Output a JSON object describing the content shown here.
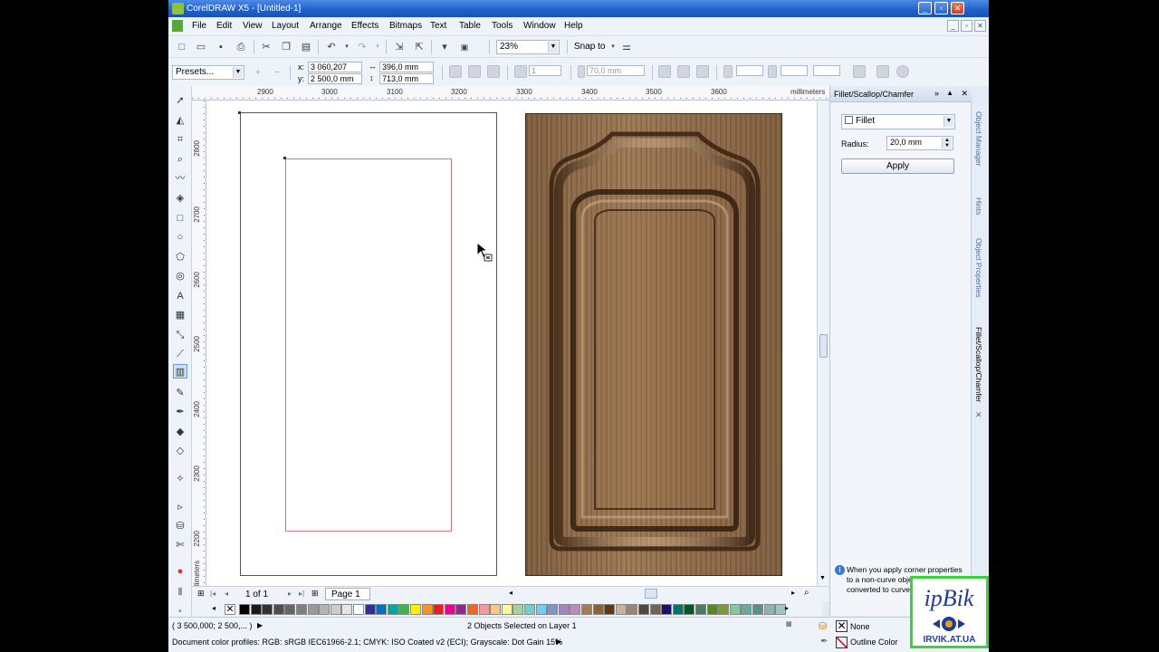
{
  "window": {
    "title": "CorelDRAW X5 - [Untitled-1]"
  },
  "menu": [
    "File",
    "Edit",
    "View",
    "Layout",
    "Arrange",
    "Effects",
    "Bitmaps",
    "Text",
    "Table",
    "Tools",
    "Window",
    "Help"
  ],
  "standard_toolbar": {
    "zoom": "23%",
    "snap_to": "Snap to"
  },
  "property_bar": {
    "presets": "Presets...",
    "x": "3 060,207 mm",
    "y": "2 500,0 mm",
    "width": "396,0 mm",
    "height": "713,0 mm",
    "corner_radius": "70,0 mm",
    "count": "1",
    "x_label": "x:",
    "y_label": "y:"
  },
  "ruler": {
    "h_labels": [
      "2900",
      "3000",
      "3100",
      "3200",
      "3300",
      "3400",
      "3500",
      "3600"
    ],
    "units": "millimeters",
    "v_labels": [
      "2800",
      "2700",
      "2600",
      "2500",
      "2400",
      "2300",
      "2200"
    ],
    "v_units": "millimeters"
  },
  "doc_nav": {
    "page_count": "1 of 1",
    "page_tab": "Page 1"
  },
  "palette_colors": [
    "#000000",
    "#1a1a1a",
    "#333333",
    "#4d4d4d",
    "#666666",
    "#808080",
    "#999999",
    "#b3b3b3",
    "#cccccc",
    "#e6e6e6",
    "#ffffff",
    "#2e3192",
    "#0072bc",
    "#00a99d",
    "#39b54a",
    "#fff200",
    "#f7941d",
    "#ed1c24",
    "#ec008c",
    "#92278f",
    "#f26522",
    "#f5989d",
    "#fdc689",
    "#fff799",
    "#a3d39c",
    "#7accc8",
    "#6dcff6",
    "#8393ca",
    "#a186be",
    "#bd8cbf",
    "#a67c52",
    "#8c6239",
    "#603913",
    "#c7b299",
    "#998675",
    "#534741",
    "#736357",
    "#1b1464",
    "#00746b",
    "#005826",
    "#4b7c5f",
    "#598527",
    "#7a9a3a",
    "#82ca9c",
    "#6aa9a0",
    "#5c8f8a",
    "#8fb3b0",
    "#a0c4c0"
  ],
  "docker": {
    "title": "Fillet/Scallop/Chamfer",
    "operation": "Fillet",
    "radius_label": "Radius:",
    "radius_value": "20,0 mm",
    "apply_label": "Apply",
    "hint": "When you apply corner properties to a non-curve object, the object is converted to curves"
  },
  "side_tabs": [
    "Object Manager",
    "Hints",
    "Object Properties",
    "Fillet/Scallop/Chamfer"
  ],
  "status": {
    "coords": "( 3 500,000; 2 500,... )",
    "selection": "2 Objects Selected on Layer 1",
    "color_profiles": "Document color profiles: RGB: sRGB IEC61966-2.1; CMYK: ISO Coated v2 (ECI); Grayscale: Dot Gain 15%",
    "fill": "None",
    "outline": "Outline Color"
  },
  "watermark": {
    "text": "IRVIK.AT.UA",
    "logo": "ipBik"
  }
}
